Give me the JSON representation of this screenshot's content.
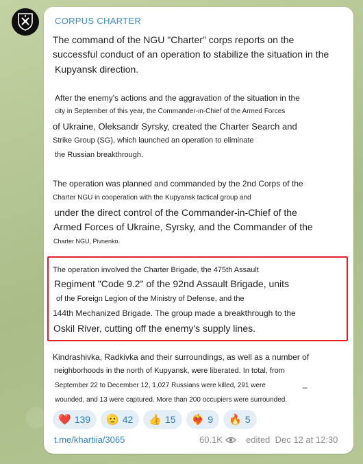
{
  "channel": {
    "name": "CORPUS CHARTER"
  },
  "post": {
    "intro": [
      "The command of the NGU \"Charter\" corps reports on the",
      "successful conduct of an operation to stabilize the situation in the",
      "Kupyansk direction."
    ],
    "para1": [
      "After the enemy's actions and the aggravation of the situation in the",
      "city in September of this year, the Commander-in-Chief of the Armed Forces",
      "of Ukraine, Oleksandr Syrsky, created the Charter Search and",
      "Strike Group (SG), which launched an operation to eliminate",
      "the Russian breakthrough."
    ],
    "para2": [
      "The operation was planned and commanded by the 2nd Corps of the",
      "Charter NGU in cooperation with the Kupyansk tactical group and",
      "under the direct control of the Commander-in-Chief of the",
      "Armed Forces of Ukraine, Syrsky, and the Commander of the",
      "Charter NGU, Pivnenko."
    ],
    "para3": [
      "The operation involved the Charter Brigade, the 475th Assault",
      "Regiment \"Code 9.2\" of the 92nd Assault Brigade, units",
      "of the Foreign Legion of the Ministry of Defense, and the",
      "144th Mechanized Brigade. The group made a breakthrough to the",
      "Oskil River, cutting off the enemy's supply lines."
    ],
    "para4": [
      "Kindrashivka, Radkivka and their surroundings, as well as a number of",
      "neighborhoods in the north of Kupyansk, were liberated. In total, from",
      "September 22 to December 12, 1,027 Russians were killed, 291 were",
      "wounded, and 13 were captured. More than 200 occupiers were surrounded."
    ],
    "dash": "–"
  },
  "reactions": [
    {
      "emoji": "❤️",
      "count": "139",
      "icon": "heart-icon"
    },
    {
      "emoji": "🫡",
      "count": "42",
      "icon": "salute-icon"
    },
    {
      "emoji": "👍",
      "count": "15",
      "icon": "thumbs-up-icon"
    },
    {
      "emoji": "❤️‍🔥",
      "count": "9",
      "icon": "heart-on-fire-icon"
    },
    {
      "emoji": "🔥",
      "count": "5",
      "icon": "fire-icon"
    }
  ],
  "footer": {
    "link": "t.me/khartiia/3065",
    "views": "60.1K",
    "edited": "edited  Dec 12 at 12:30"
  },
  "colors": {
    "accent": "#3a8cc4",
    "highlight_border": "#e0202a",
    "reaction_bg": "#e4eef7"
  }
}
